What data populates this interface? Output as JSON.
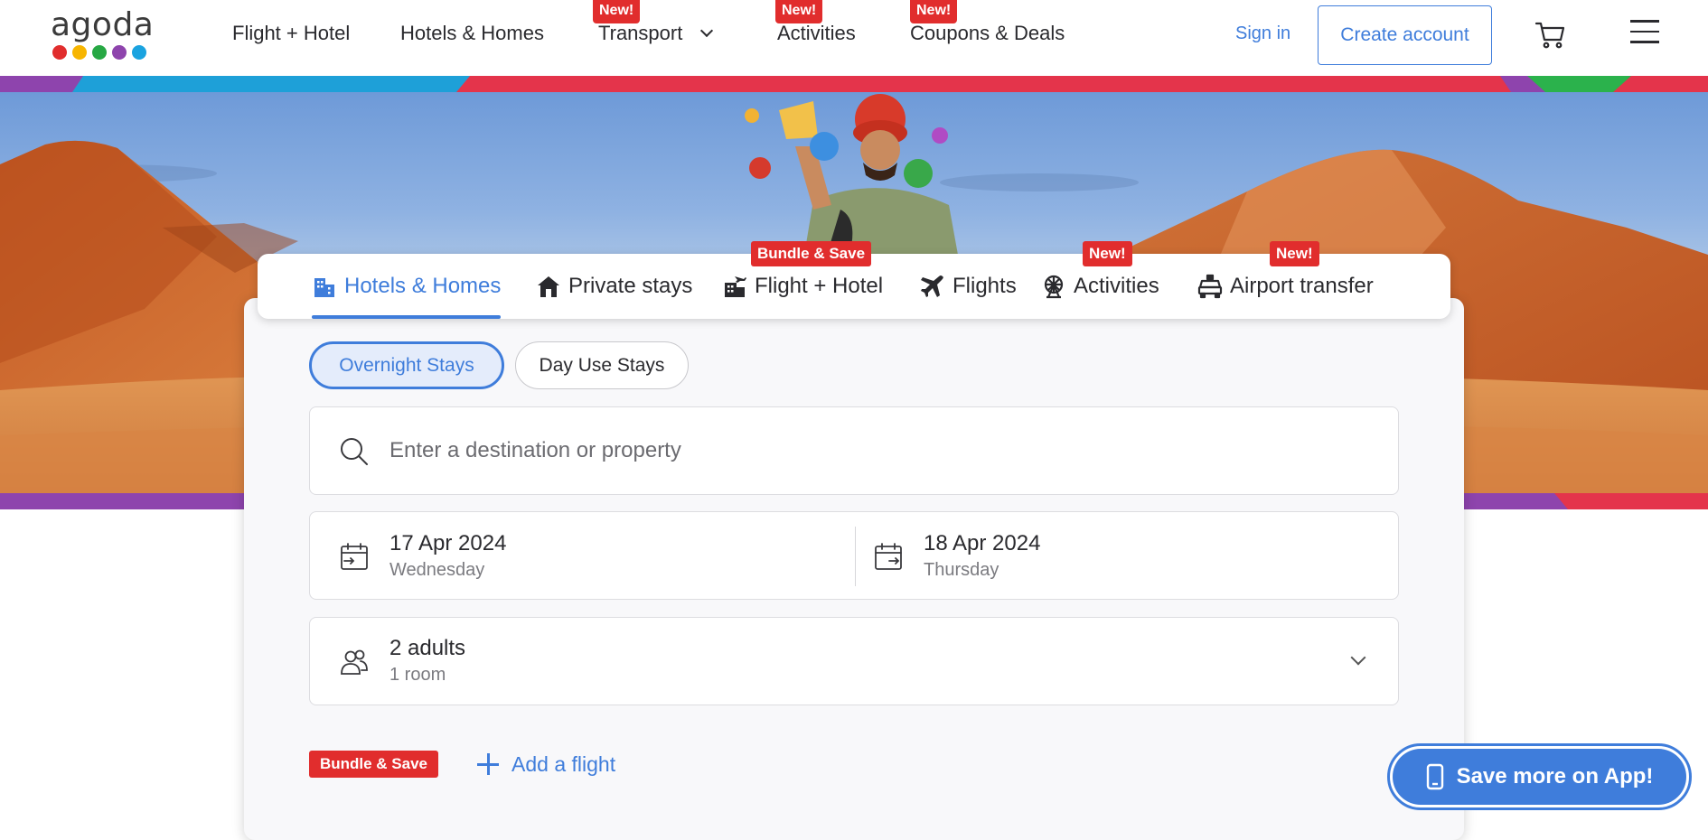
{
  "brand": {
    "logo_text": "agoda",
    "logo_dot_colors": [
      "#e12d2d",
      "#f7b500",
      "#27a844",
      "#8e44ad",
      "#1aa3e0"
    ]
  },
  "colors": {
    "accent": "#3f7ddb",
    "badge_red": "#e12d2d",
    "stripe_purple": "#8e44ad",
    "stripe_blue": "#1ea0d8",
    "stripe_red": "#e4344b",
    "stripe_green": "#2bb24c"
  },
  "nav": {
    "items": [
      {
        "label": "Flight + Hotel",
        "badge": ""
      },
      {
        "label": "Hotels & Homes",
        "badge": ""
      },
      {
        "label": "Transport",
        "badge": "New!",
        "icon": "chevron-down-icon"
      },
      {
        "label": "Activities",
        "badge": "New!"
      },
      {
        "label": "Coupons & Deals",
        "badge": "New!"
      }
    ],
    "sign_in": "Sign in",
    "create_account": "Create account",
    "cart_icon": "cart-icon",
    "menu_icon": "hamburger-menu-icon"
  },
  "tabs": [
    {
      "label": "Hotels & Homes",
      "icon": "hotel-building-icon",
      "active": true,
      "badge": ""
    },
    {
      "label": "Private stays",
      "icon": "house-icon",
      "active": false,
      "badge": ""
    },
    {
      "label": "Flight + Hotel",
      "icon": "flight-hotel-icon",
      "active": false,
      "badge": "Bundle & Save"
    },
    {
      "label": "Flights",
      "icon": "airplane-icon",
      "active": false,
      "badge": ""
    },
    {
      "label": "Activities",
      "icon": "ferris-wheel-icon",
      "active": false,
      "badge": "New!"
    },
    {
      "label": "Airport transfer",
      "icon": "car-icon",
      "active": false,
      "badge": "New!"
    }
  ],
  "stay_type": {
    "overnight": "Overnight Stays",
    "day_use": "Day Use Stays",
    "selected": "Overnight Stays"
  },
  "search": {
    "placeholder": "Enter a destination or property",
    "icon": "search-icon"
  },
  "dates": {
    "check_in": {
      "date": "17 Apr 2024",
      "day": "Wednesday",
      "icon": "calendar-checkin-icon"
    },
    "check_out": {
      "date": "18 Apr 2024",
      "day": "Thursday",
      "icon": "calendar-checkout-icon"
    }
  },
  "guests": {
    "summary": "2 adults",
    "rooms": "1 room",
    "icon": "people-icon"
  },
  "bundle": {
    "badge": "Bundle & Save",
    "add_flight": "Add a flight",
    "icon": "plus-icon"
  },
  "app_promo": {
    "label": "Save more on App!",
    "icon": "mobile-phone-icon"
  }
}
